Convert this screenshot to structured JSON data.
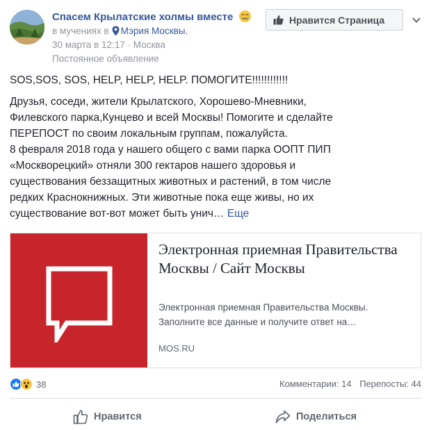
{
  "header": {
    "page_name": "Спасем Крылатские холмы вместе",
    "feeling_prefix": "в мучениях в",
    "location": "Мэрия Москвы.",
    "date": "30 марта в 12:17",
    "separator": "·",
    "city": "Москва",
    "pinned_label": "Постоянное объявление",
    "like_page_label": "Нравится Страница"
  },
  "post": {
    "headline": "SOS,SOS, SOS, HELP, HELP, HELP. ПОМОГИТЕ!!!!!!!!!!!!",
    "lines": [
      "Друзья, соседи, жители Крылатского, Хорошево-Мневники,",
      "Филевского парка,Кунцево и всей Москвы! Помогите и сделайте",
      "ПЕРЕПОСТ по своим локальным группам, пожалуйста.",
      "8 февраля 2018 года у нашего общего с вами парка ООПТ ПИП",
      "«Москворецкий» отняли 300 гектаров нашего здоровья и",
      "существования беззащитных животных и растений, в том числе",
      "редких Краснокнижных. Эти животные пока еще живы, но их",
      "существование вот-вот может быть унич…"
    ],
    "see_more": "Еще"
  },
  "link_preview": {
    "title": "Электронная приемная Правительства Москвы / Сайт Москвы",
    "description": "Электронная приемная Правительства Москвы. Заполните все данные и получите ответ на…",
    "domain": "MOS.RU",
    "brand_color": "#c8242b"
  },
  "engagement": {
    "reaction_count": "38",
    "comments": "Комментарии: 14",
    "shares": "Перепосты: 44",
    "like_action": "Нравится",
    "share_action": "Поделиться"
  },
  "colors": {
    "link": "#365899",
    "secondary_text": "#90949c",
    "like_blue": "#1877f2",
    "wow_yellow": "#f7c840"
  }
}
